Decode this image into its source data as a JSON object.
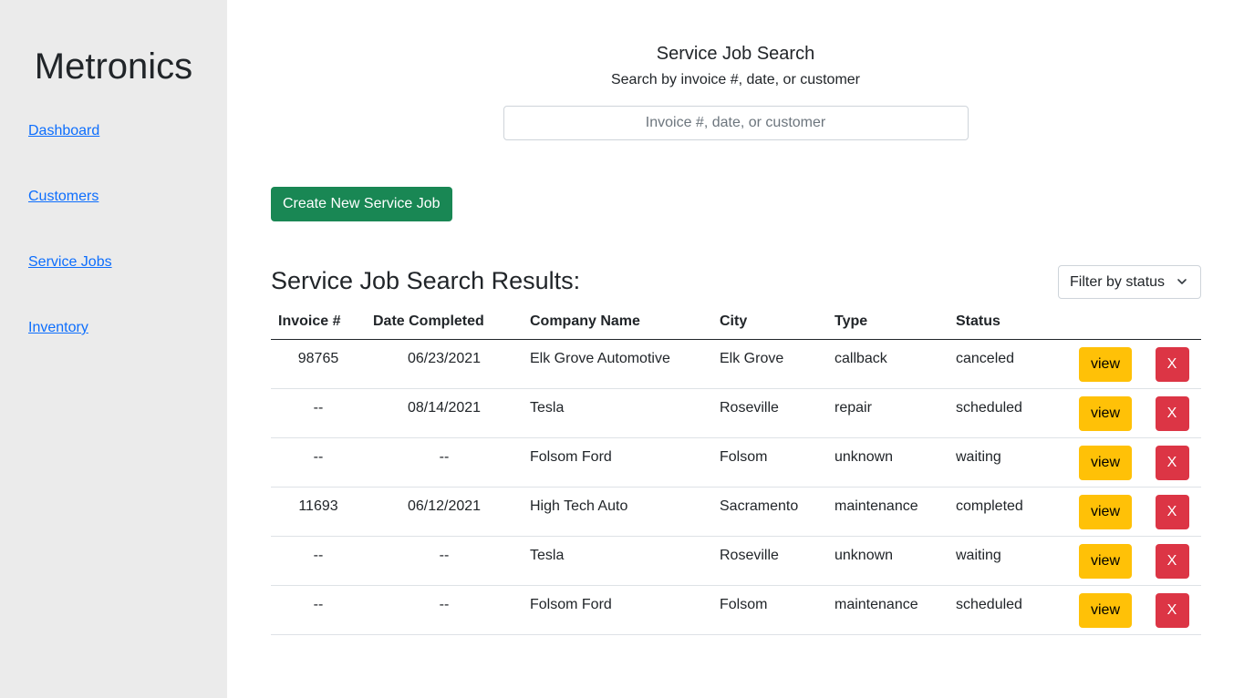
{
  "sidebar": {
    "brand": "Metronics",
    "nav": [
      {
        "label": "Dashboard"
      },
      {
        "label": "Customers"
      },
      {
        "label": "Service Jobs"
      },
      {
        "label": "Inventory"
      }
    ]
  },
  "search": {
    "title": "Service Job Search",
    "subtitle": "Search by invoice #, date, or customer",
    "placeholder": "Invoice #, date, or customer",
    "value": ""
  },
  "actions": {
    "create_label": "Create New Service Job"
  },
  "results": {
    "title": "Service Job Search Results:",
    "filter_label": "Filter by status",
    "columns": [
      "Invoice #",
      "Date Completed",
      "Company Name",
      "City",
      "Type",
      "Status"
    ],
    "view_label": "view",
    "delete_label": "X",
    "rows": [
      {
        "invoice": "98765",
        "date": "06/23/2021",
        "company": "Elk Grove Automotive",
        "city": "Elk Grove",
        "type": "callback",
        "status": "canceled"
      },
      {
        "invoice": "--",
        "date": "08/14/2021",
        "company": "Tesla",
        "city": "Roseville",
        "type": "repair",
        "status": "scheduled"
      },
      {
        "invoice": "--",
        "date": "--",
        "company": "Folsom Ford",
        "city": "Folsom",
        "type": "unknown",
        "status": "waiting"
      },
      {
        "invoice": "11693",
        "date": "06/12/2021",
        "company": "High Tech Auto",
        "city": "Sacramento",
        "type": "maintenance",
        "status": "completed"
      },
      {
        "invoice": "--",
        "date": "--",
        "company": "Tesla",
        "city": "Roseville",
        "type": "unknown",
        "status": "waiting"
      },
      {
        "invoice": "--",
        "date": "--",
        "company": "Folsom Ford",
        "city": "Folsom",
        "type": "maintenance",
        "status": "scheduled"
      }
    ]
  },
  "colors": {
    "sidebar_bg": "#ebebeb",
    "link": "#0d6efd",
    "create_button": "#198754",
    "view_button": "#ffc107",
    "delete_button": "#dc3545"
  },
  "icons": {
    "filter_chevron": "chevron-down-icon"
  }
}
